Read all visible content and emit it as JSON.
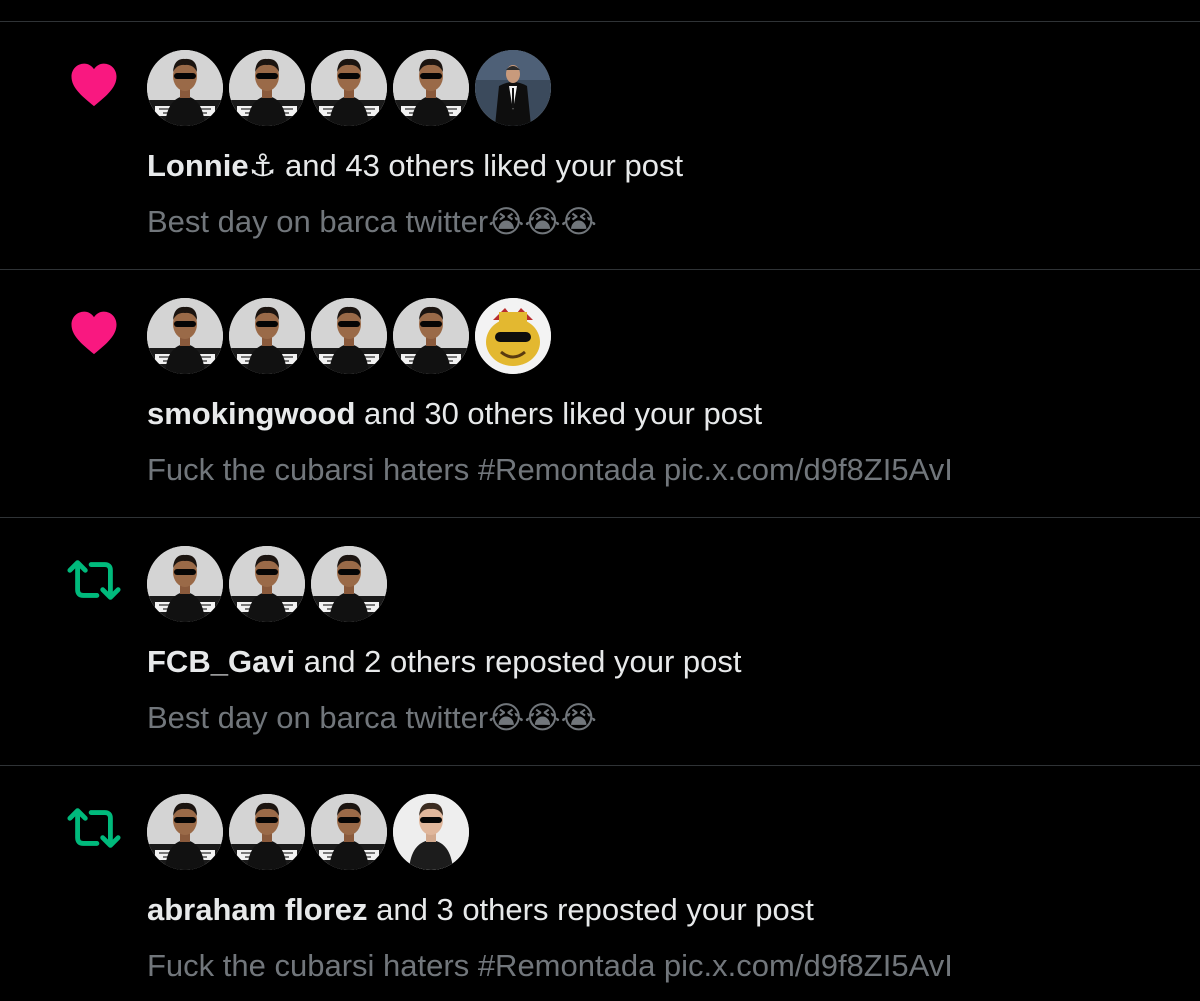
{
  "colors": {
    "background": "#000000",
    "divider": "#2f3336",
    "like": "#f91880",
    "repost": "#00ba7c",
    "text_primary": "#e7e9ea",
    "text_secondary": "#71767b"
  },
  "notifications": [
    {
      "type": "like",
      "icon": "heart-icon",
      "user": "Lonnie⚓",
      "action": " and 43 others liked your post",
      "preview": "Best day on barca twitter😭😭😭",
      "avatars": [
        "avatar-player",
        "avatar-player",
        "avatar-player",
        "avatar-player",
        "avatar-suit"
      ]
    },
    {
      "type": "like",
      "icon": "heart-icon",
      "user": "smokingwood",
      "action": " and 30 others liked your post",
      "preview": "Fuck the cubarsi haters #Remontada pic.x.com/d9f8ZI5AvI",
      "avatars": [
        "avatar-player",
        "avatar-player",
        "avatar-player",
        "avatar-player",
        "avatar-cartoon"
      ]
    },
    {
      "type": "repost",
      "icon": "repost-icon",
      "user": "FCB_Gavi",
      "action": " and 2 others reposted your post",
      "preview": "Best day on barca twitter😭😭😭",
      "avatars": [
        "avatar-player",
        "avatar-player",
        "avatar-player"
      ]
    },
    {
      "type": "repost",
      "icon": "repost-icon",
      "user": "abraham florez",
      "action": " and 3 others reposted your post",
      "preview": "Fuck the cubarsi haters #Remontada pic.x.com/d9f8ZI5AvI",
      "avatars": [
        "avatar-player",
        "avatar-player",
        "avatar-player",
        "avatar-photo"
      ]
    }
  ]
}
